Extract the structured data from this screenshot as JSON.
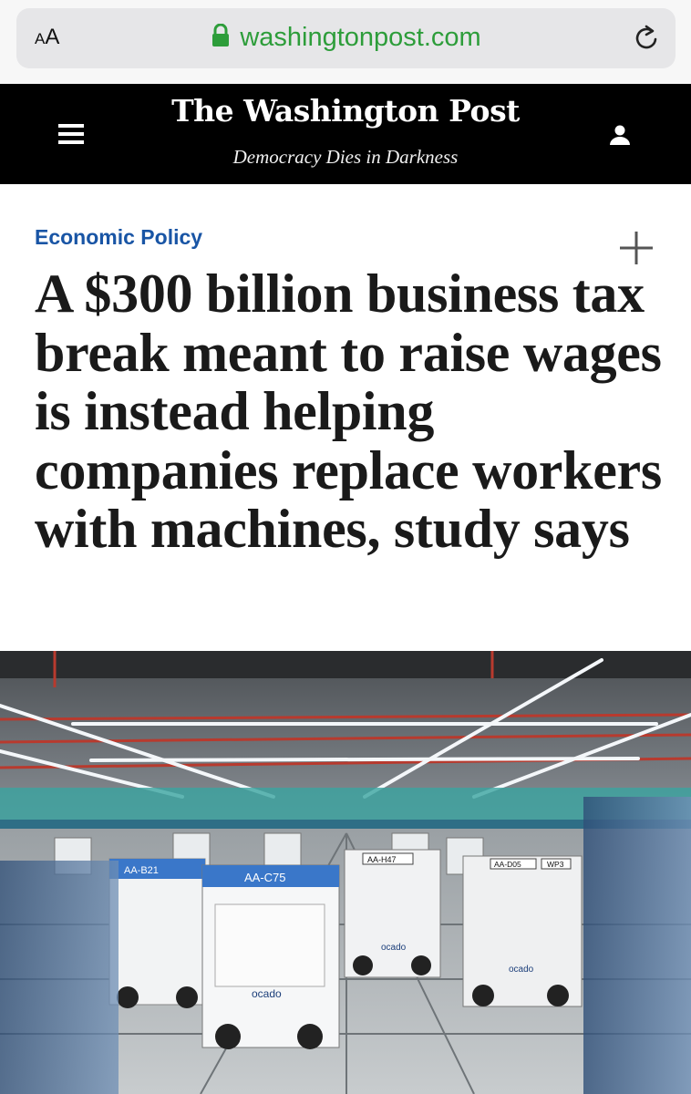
{
  "browser": {
    "text_size_label_small": "A",
    "text_size_label_large": "A",
    "url": "washingtonpost.com",
    "icons": [
      "lock-icon",
      "reload-icon"
    ]
  },
  "header": {
    "logo": "The Washington Post",
    "tagline": "Democracy Dies in Darkness",
    "icons": [
      "hamburger-menu-icon",
      "user-account-icon"
    ],
    "background": "#000000"
  },
  "article": {
    "section": "Economic Policy",
    "section_color": "#1955a5",
    "headline": "A $300 billion business tax break meant to raise wages is instead helping companies replace workers with machines, study says",
    "save_icon": "plus-icon"
  },
  "photo": {
    "robot_labels": [
      "AA-B21",
      "AA-C75",
      "AA-H47",
      "AA-D05",
      "WP3"
    ],
    "brand_text": "ocado"
  }
}
